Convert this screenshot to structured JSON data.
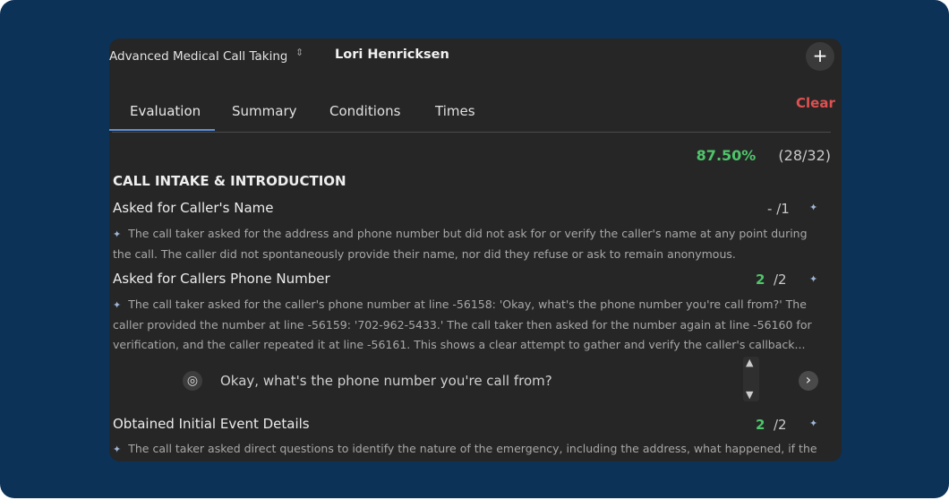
{
  "header": {
    "course": "Advanced Medical Call Taking",
    "person": "Lori Henricksen",
    "add_icon": "plus-icon",
    "select_icon": "chevron-updown-icon"
  },
  "tabs": [
    {
      "label": "Evaluation",
      "active": true
    },
    {
      "label": "Summary",
      "active": false
    },
    {
      "label": "Conditions",
      "active": false
    },
    {
      "label": "Times",
      "active": false
    }
  ],
  "clear_label": "Clear",
  "score": {
    "percent": "87.50%",
    "fraction": "(28/32)"
  },
  "section": {
    "title": "CALL INTAKE & INTRODUCTION"
  },
  "items": [
    {
      "title": "Asked for Caller's Name",
      "earned": "-",
      "max": "/1",
      "explanation": "The call taker asked for the address and phone number but did not ask for or verify the caller's name at any point during the call. The caller did not spontaneously provide their name, nor did they refuse or ask to remain anonymous."
    },
    {
      "title": "Asked for Callers Phone Number",
      "earned": "2",
      "max": "/2",
      "explanation": "The call taker asked for the caller's phone number at line -56158: 'Okay, what's the phone number you're call from?' The caller provided the number at line -56159: '702-962-5433.' The call taker then asked for the number again at line -56160 for verification, and the caller repeated it at line -56161. This shows a clear attempt to gather and verify the caller's callback..."
    },
    {
      "title": "Obtained Initial Event Details",
      "earned": "2",
      "max": "/2",
      "explanation": "The call taker asked direct questions to identify the nature of the emergency, including the address, what happened, if the"
    }
  ],
  "quote": {
    "text": "Okay, what's the phone number you're call from?"
  },
  "colors": {
    "background": "#0d3257",
    "panel": "#262626",
    "accent": "#4ec56a",
    "clear": "#e05050",
    "tab_underline": "#5b8fd6"
  }
}
